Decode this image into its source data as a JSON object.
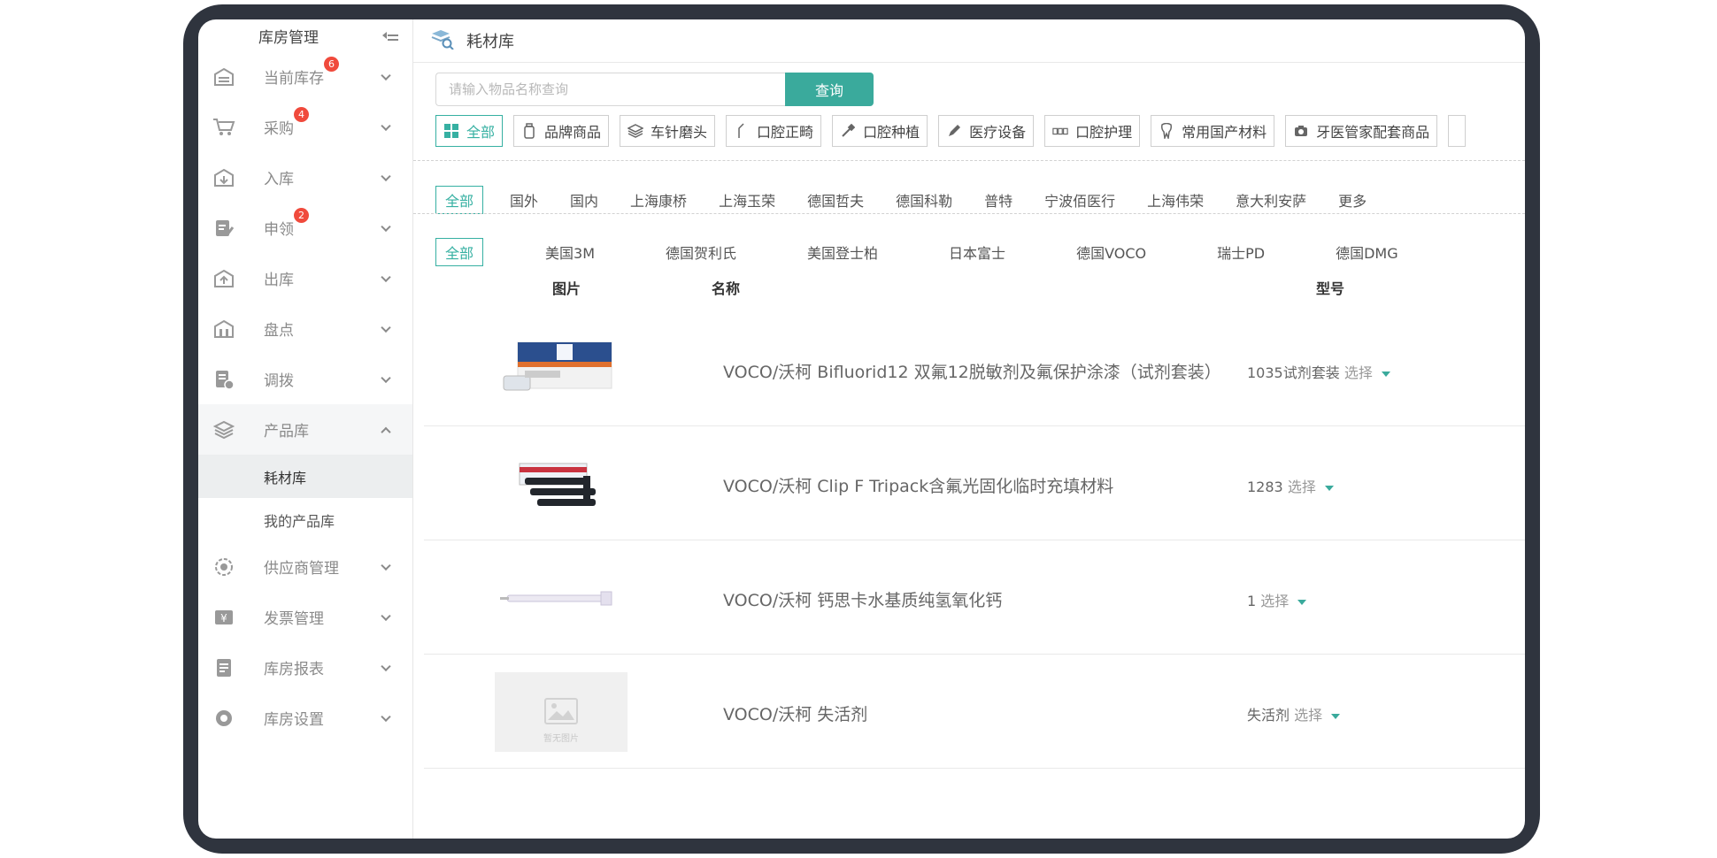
{
  "sidebar": {
    "title": "库房管理",
    "items": [
      {
        "label": "当前库存",
        "badge": "6",
        "icon": "warehouse-icon"
      },
      {
        "label": "采购",
        "badge": "4",
        "icon": "cart-icon"
      },
      {
        "label": "入库",
        "badge": "",
        "icon": "stock-in-icon"
      },
      {
        "label": "申领",
        "badge": "2",
        "icon": "request-icon"
      },
      {
        "label": "出库",
        "badge": "",
        "icon": "stock-out-icon"
      },
      {
        "label": "盘点",
        "badge": "",
        "icon": "inventory-check-icon"
      },
      {
        "label": "调拨",
        "badge": "",
        "icon": "transfer-icon"
      },
      {
        "label": "产品库",
        "badge": "",
        "icon": "layers-icon"
      },
      {
        "label": "供应商管理",
        "badge": "",
        "icon": "supplier-icon"
      },
      {
        "label": "发票管理",
        "badge": "",
        "icon": "invoice-icon"
      },
      {
        "label": "库房报表",
        "badge": "",
        "icon": "report-icon"
      },
      {
        "label": "库房设置",
        "badge": "",
        "icon": "settings-icon"
      }
    ],
    "sub_items": [
      "耗材库",
      "我的产品库"
    ]
  },
  "header": {
    "title": "耗材库",
    "icon": "consumables-icon"
  },
  "search": {
    "placeholder": "请输入物品名称查询",
    "button": "查询"
  },
  "categories": [
    {
      "label": "全部",
      "icon": "grid-icon"
    },
    {
      "label": "品牌商品",
      "icon": "bottle-icon"
    },
    {
      "label": "车针磨头",
      "icon": "layers-icon"
    },
    {
      "label": "口腔正畸",
      "icon": "tooth-tool-icon"
    },
    {
      "label": "口腔种植",
      "icon": "implant-icon"
    },
    {
      "label": "医疗设备",
      "icon": "pen-icon"
    },
    {
      "label": "口腔护理",
      "icon": "teeth-icon"
    },
    {
      "label": "常用国产材料",
      "icon": "tooth-icon"
    },
    {
      "label": "牙医管家配套商品",
      "icon": "camera-icon"
    }
  ],
  "origins": [
    "全部",
    "国外",
    "国内",
    "上海康桥",
    "上海玉荣",
    "德国哲夫",
    "德国科勒",
    "普特",
    "宁波佰医行",
    "上海伟荣",
    "意大利安萨",
    "更多"
  ],
  "brands": [
    "全部",
    "美国3M",
    "德国贺利氏",
    "美国登士柏",
    "日本富士",
    "德国VOCO",
    "瑞士PD",
    "德国DMG"
  ],
  "table": {
    "headers": {
      "image": "图片",
      "name": "名称",
      "model": "型号"
    },
    "select_label": "选择",
    "placeholder_image_text": "暂无图片",
    "rows": [
      {
        "name": "VOCO/沃柯 Bifluorid12 双氟12脱敏剂及氟保护涂漆（试剂套装）",
        "model": "1035试剂套装"
      },
      {
        "name": "VOCO/沃柯 Clip F Tripack含氟光固化临时充填材料",
        "model": "1283"
      },
      {
        "name": "VOCO/沃柯 钙思卡水基质纯氢氧化钙",
        "model": "1"
      },
      {
        "name": "VOCO/沃柯 失活剂",
        "model": "失活剂"
      }
    ]
  },
  "colors": {
    "accent": "#3aaa9c",
    "badge": "#f04a3c",
    "frame": "#2f343e"
  }
}
